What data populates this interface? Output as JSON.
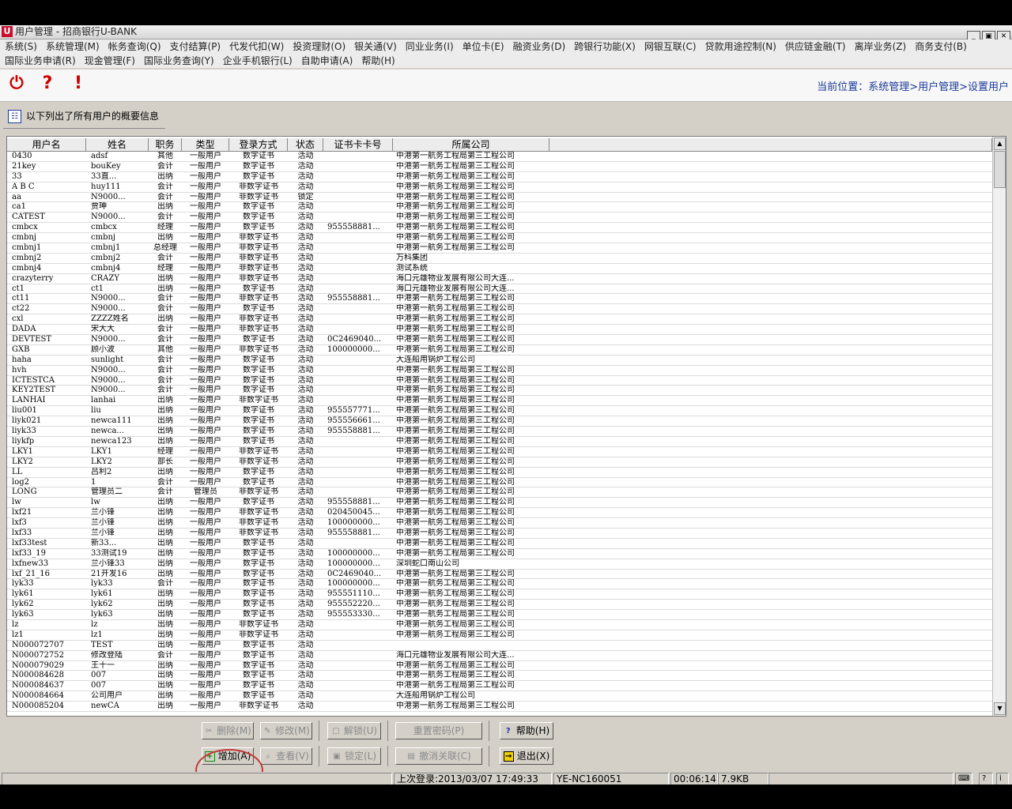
{
  "window": {
    "logo": "U",
    "title": "用户管理 - 招商银行U-BANK",
    "buttons": [
      "_",
      "▣",
      "✕"
    ]
  },
  "menu": {
    "row1": [
      "系统(S)",
      "系统管理(M)",
      "帐务查询(Q)",
      "支付结算(P)",
      "代发代扣(W)",
      "投资理财(O)",
      "银关通(V)",
      "同业业务(I)",
      "单位卡(E)",
      "融资业务(D)",
      "跨银行功能(X)",
      "网银互联(C)",
      "贷款用途控制(N)",
      "供应链金融(T)",
      "离岸业务(Z)",
      "商务支付(B)"
    ],
    "row2": [
      "国际业务申请(R)",
      "现金管理(F)",
      "国际业务查询(Y)",
      "企业手机银行(L)",
      "自助申请(A)",
      "帮助(H)"
    ]
  },
  "toolbar": {
    "icons": [
      "power-icon",
      "help-icon",
      "alert-icon"
    ],
    "power": "⏻",
    "help": "?",
    "alert": "!",
    "breadcrumb": "当前位置：系统管理>用户管理>设置用户"
  },
  "info": {
    "icon": "☷",
    "text": "以下列出了所有用户的概要信息"
  },
  "table": {
    "headers": [
      "用户名",
      "姓名",
      "职务",
      "类型",
      "登录方式",
      "状态",
      "证书卡卡号",
      "所属公司"
    ],
    "rows": [
      [
        "0430",
        "adsf",
        "其他",
        "一般用户",
        "数字证书",
        "活动",
        "",
        "中港第一航务工程局第三工程公司"
      ],
      [
        "21key",
        "bouKey",
        "会计",
        "一般用户",
        "数字证书",
        "活动",
        "",
        "中港第一航务工程局第三工程公司"
      ],
      [
        "33",
        "33直...",
        "出纳",
        "一般用户",
        "数字证书",
        "活动",
        "",
        "中港第一航务工程局第三工程公司"
      ],
      [
        "A B C",
        "huy111",
        "会计",
        "一般用户",
        "非数字证书",
        "活动",
        "",
        "中港第一航务工程局第三工程公司"
      ],
      [
        "aa",
        "N9000...",
        "会计",
        "一般用户",
        "非数字证书",
        "锁定",
        "",
        "中港第一航务工程局第三工程公司"
      ],
      [
        "ca1",
        "贾珅",
        "出纳",
        "一般用户",
        "数字证书",
        "活动",
        "",
        "中港第一航务工程局第三工程公司"
      ],
      [
        "CATEST",
        "N9000...",
        "会计",
        "一般用户",
        "数字证书",
        "活动",
        "",
        "中港第一航务工程局第三工程公司"
      ],
      [
        "cmbcx",
        "cmbcx",
        "经理",
        "一般用户",
        "数字证书",
        "活动",
        "955558881...",
        "中港第一航务工程局第三工程公司"
      ],
      [
        "cmbnj",
        "cmbnj",
        "出纳",
        "一般用户",
        "非数字证书",
        "活动",
        "",
        "中港第一航务工程局第三工程公司"
      ],
      [
        "cmbnj1",
        "cmbnj1",
        "总经理",
        "一般用户",
        "非数字证书",
        "活动",
        "",
        "中港第一航务工程局第三工程公司"
      ],
      [
        "cmbnj2",
        "cmbnj2",
        "会计",
        "一般用户",
        "非数字证书",
        "活动",
        "",
        "万科集团"
      ],
      [
        "cmbnj4",
        "cmbnj4",
        "经理",
        "一般用户",
        "非数字证书",
        "活动",
        "",
        "测试系统"
      ],
      [
        "crazyterry",
        "CRAZY",
        "出纳",
        "一般用户",
        "非数字证书",
        "活动",
        "",
        "海口元雄物业发展有限公司大连..."
      ],
      [
        "ct1",
        "ct1",
        "出纳",
        "一般用户",
        "数字证书",
        "活动",
        "",
        "海口元雄物业发展有限公司大连..."
      ],
      [
        "ct11",
        "N9000...",
        "会计",
        "一般用户",
        "非数字证书",
        "活动",
        "955558881...",
        "中港第一航务工程局第三工程公司"
      ],
      [
        "ct22",
        "N9000...",
        "会计",
        "一般用户",
        "数字证书",
        "活动",
        "",
        "中港第一航务工程局第三工程公司"
      ],
      [
        "cxl",
        "ZZZZ姓名",
        "出纳",
        "一般用户",
        "非数字证书",
        "活动",
        "",
        "中港第一航务工程局第三工程公司"
      ],
      [
        "DADA",
        "宋大大",
        "会计",
        "一般用户",
        "非数字证书",
        "活动",
        "",
        "中港第一航务工程局第三工程公司"
      ],
      [
        "DEVTEST",
        "N9000...",
        "会计",
        "一般用户",
        "数字证书",
        "活动",
        "0C2469040...",
        "中港第一航务工程局第三工程公司"
      ],
      [
        "GXB",
        "顾小波",
        "其他",
        "一般用户",
        "非数字证书",
        "活动",
        "100000000...",
        "中港第一航务工程局第三工程公司"
      ],
      [
        "haha",
        "sunlight",
        "会计",
        "一般用户",
        "数字证书",
        "活动",
        "",
        "大连船用锅炉工程公司"
      ],
      [
        "hvh",
        "N9000...",
        "会计",
        "一般用户",
        "数字证书",
        "活动",
        "",
        "中港第一航务工程局第三工程公司"
      ],
      [
        "ICTESTCA",
        "N9000...",
        "会计",
        "一般用户",
        "数字证书",
        "活动",
        "",
        "中港第一航务工程局第三工程公司"
      ],
      [
        "KEY2TEST",
        "N9000...",
        "会计",
        "一般用户",
        "数字证书",
        "活动",
        "",
        "中港第一航务工程局第三工程公司"
      ],
      [
        "LANHAI",
        "lanhai",
        "出纳",
        "一般用户",
        "非数字证书",
        "活动",
        "",
        "中港第一航务工程局第三工程公司"
      ],
      [
        "liu001",
        "liu",
        "出纳",
        "一般用户",
        "数字证书",
        "活动",
        "955557771...",
        "中港第一航务工程局第三工程公司"
      ],
      [
        "liyk021",
        "newca111",
        "出纳",
        "一般用户",
        "数字证书",
        "活动",
        "955556661...",
        "中港第一航务工程局第三工程公司"
      ],
      [
        "liyk33",
        "newca...",
        "出纳",
        "一般用户",
        "数字证书",
        "活动",
        "955558881...",
        "中港第一航务工程局第三工程公司"
      ],
      [
        "liykfp",
        "newca123",
        "出纳",
        "一般用户",
        "数字证书",
        "活动",
        "",
        "中港第一航务工程局第三工程公司"
      ],
      [
        "LKY1",
        "LKY1",
        "经理",
        "一般用户",
        "非数字证书",
        "活动",
        "",
        "中港第一航务工程局第三工程公司"
      ],
      [
        "LKY2",
        "LKY2",
        "部长",
        "一般用户",
        "非数字证书",
        "活动",
        "",
        "中港第一航务工程局第三工程公司"
      ],
      [
        "LL",
        "吕利2",
        "出纳",
        "一般用户",
        "数字证书",
        "活动",
        "",
        "中港第一航务工程局第三工程公司"
      ],
      [
        "log2",
        "1",
        "会计",
        "一般用户",
        "数字证书",
        "活动",
        "",
        "中港第一航务工程局第三工程公司"
      ],
      [
        "LONG",
        "管理员二",
        "会计",
        "管理员",
        "非数字证书",
        "活动",
        "",
        "中港第一航务工程局第三工程公司"
      ],
      [
        "lw",
        "lw",
        "出纳",
        "一般用户",
        "数字证书",
        "活动",
        "955558881...",
        "中港第一航务工程局第三工程公司"
      ],
      [
        "lxf21",
        "兰小锋",
        "出纳",
        "一般用户",
        "非数字证书",
        "活动",
        "020450045...",
        "中港第一航务工程局第三工程公司"
      ],
      [
        "lxf3",
        "兰小锋",
        "出纳",
        "一般用户",
        "非数字证书",
        "活动",
        "100000000...",
        "中港第一航务工程局第三工程公司"
      ],
      [
        "lxf33",
        "兰小锋",
        "出纳",
        "一般用户",
        "非数字证书",
        "活动",
        "955558881...",
        "中港第一航务工程局第三工程公司"
      ],
      [
        "lxf33test",
        "新33...",
        "出纳",
        "一般用户",
        "数字证书",
        "活动",
        "",
        "中港第一航务工程局第三工程公司"
      ],
      [
        "lxf33_19",
        "33测试19",
        "出纳",
        "一般用户",
        "数字证书",
        "活动",
        "100000000...",
        "中港第一航务工程局第三工程公司"
      ],
      [
        "lxfnew33",
        "兰小锋33",
        "出纳",
        "一般用户",
        "数字证书",
        "活动",
        "100000000...",
        "深圳蛇口南山公司"
      ],
      [
        "lxf_21_16",
        "21开发16",
        "出纳",
        "一般用户",
        "数字证书",
        "活动",
        "0C2469040...",
        "中港第一航务工程局第三工程公司"
      ],
      [
        "lyk33",
        "lyk33",
        "会计",
        "一般用户",
        "数字证书",
        "活动",
        "100000000...",
        "中港第一航务工程局第三工程公司"
      ],
      [
        "lyk61",
        "lyk61",
        "出纳",
        "一般用户",
        "数字证书",
        "活动",
        "955551110...",
        "中港第一航务工程局第三工程公司"
      ],
      [
        "lyk62",
        "lyk62",
        "出纳",
        "一般用户",
        "数字证书",
        "活动",
        "955552220...",
        "中港第一航务工程局第三工程公司"
      ],
      [
        "lyk63",
        "lyk63",
        "出纳",
        "一般用户",
        "数字证书",
        "活动",
        "955553330...",
        "中港第一航务工程局第三工程公司"
      ],
      [
        "lz",
        "lz",
        "出纳",
        "一般用户",
        "非数字证书",
        "活动",
        "",
        "中港第一航务工程局第三工程公司"
      ],
      [
        "lz1",
        "lz1",
        "出纳",
        "一般用户",
        "非数字证书",
        "活动",
        "",
        "中港第一航务工程局第三工程公司"
      ],
      [
        "N000072707",
        "TEST",
        "出纳",
        "一般用户",
        "数字证书",
        "活动",
        "",
        ""
      ],
      [
        "N000072752",
        "修改登陆",
        "会计",
        "一般用户",
        "数字证书",
        "活动",
        "",
        "海口元雄物业发展有限公司大连..."
      ],
      [
        "N000079029",
        "王十一",
        "出纳",
        "一般用户",
        "数字证书",
        "活动",
        "",
        "中港第一航务工程局第三工程公司"
      ],
      [
        "N000084628",
        "007",
        "出纳",
        "一般用户",
        "数字证书",
        "活动",
        "",
        "中港第一航务工程局第三工程公司"
      ],
      [
        "N000084637",
        "007",
        "出纳",
        "一般用户",
        "数字证书",
        "活动",
        "",
        "中港第一航务工程局第三工程公司"
      ],
      [
        "N000084664",
        "公司用户",
        "出纳",
        "一般用户",
        "数字证书",
        "活动",
        "",
        "大连船用锅炉工程公司"
      ],
      [
        "N000085204",
        "newCA",
        "出纳",
        "一般用户",
        "非数字证书",
        "活动",
        "",
        "中港第一航务工程局第三工程公司"
      ]
    ]
  },
  "buttons": {
    "delete": "删除(M)",
    "modify": "修改(M)",
    "unlock": "解锁(U)",
    "reset_password": "重置密码(P)",
    "help": "帮助(H)",
    "add": "增加(A)",
    "view": "查看(V)",
    "lock": "锁定(L)",
    "cancel_link": "撤消关联(C)",
    "exit": "退出(X)"
  },
  "status": {
    "last_login": "上次登录:2013/03/07 17:49:33",
    "machine": "YE-NC160051",
    "elapsed": "00:06:14",
    "size": "7.9KB"
  },
  "colors": {
    "highlight_circle": "#c23a3a",
    "breadcrumb": "#1a3a9c",
    "logo": "#c8102e"
  }
}
